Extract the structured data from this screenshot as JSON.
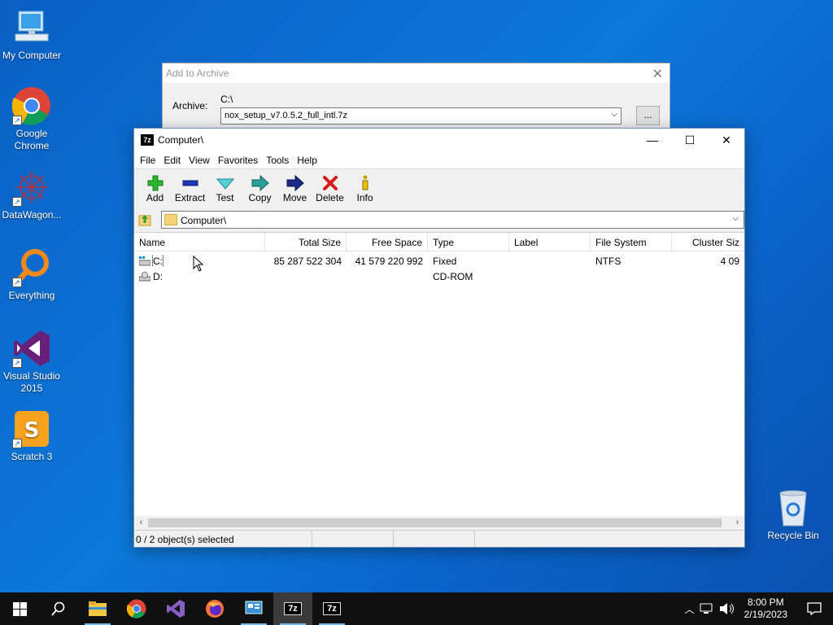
{
  "desktop": {
    "icons": [
      {
        "label": "My Computer"
      },
      {
        "label": "Google Chrome"
      },
      {
        "label": "DataWagon..."
      },
      {
        "label": "Everything"
      },
      {
        "label": "Visual Studio 2015"
      },
      {
        "label": "Scratch 3"
      }
    ],
    "recycle_bin": "Recycle Bin"
  },
  "bg_dialog": {
    "title": "Add to Archive",
    "archive_label": "Archive:",
    "path": "C:\\",
    "archive_name": "nox_setup_v7.0.5.2_full_intl.7z",
    "browse_label": "..."
  },
  "window": {
    "app_icon": "7z",
    "title": "Computer\\",
    "menu": [
      "File",
      "Edit",
      "View",
      "Favorites",
      "Tools",
      "Help"
    ],
    "toolbar": [
      "Add",
      "Extract",
      "Test",
      "Copy",
      "Move",
      "Delete",
      "Info"
    ],
    "address": "Computer\\",
    "columns": [
      "Name",
      "Total Size",
      "Free Space",
      "Type",
      "Label",
      "File System",
      "Cluster Siz"
    ],
    "rows": [
      {
        "name": "C:",
        "total": "85 287 522 304",
        "free": "41 579 220 992",
        "type": "Fixed",
        "label": "",
        "fs": "NTFS",
        "cluster": "4 09"
      },
      {
        "name": "D:",
        "total": "",
        "free": "",
        "type": "CD-ROM",
        "label": "",
        "fs": "",
        "cluster": ""
      }
    ],
    "status": "0 / 2 object(s) selected"
  },
  "taskbar": {
    "time": "8:00 PM",
    "date": "2/19/2023",
    "seven_zip_label": "7z"
  },
  "colors": {
    "desktop": "#0a6cd0",
    "taskbar": "#101010",
    "accent": "#76b9ed"
  }
}
